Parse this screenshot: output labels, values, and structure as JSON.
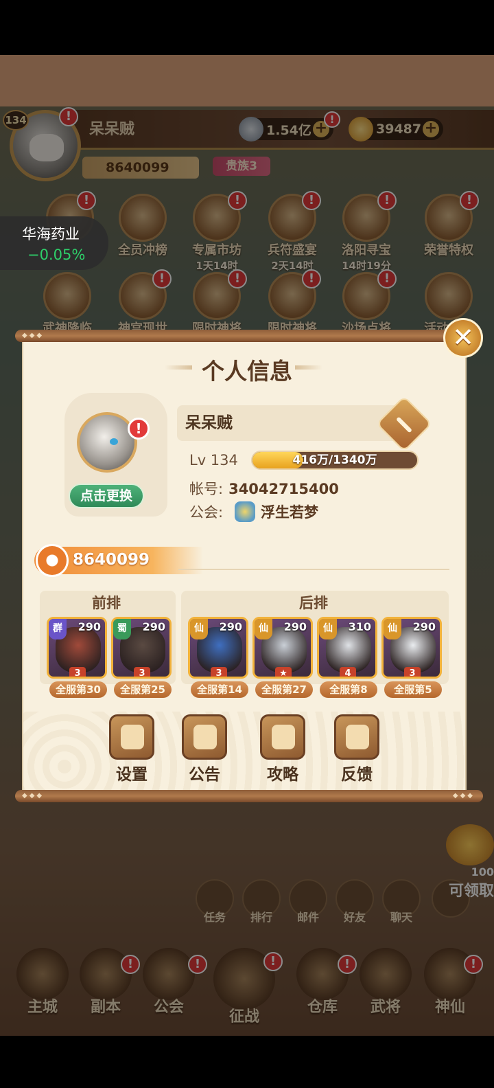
{
  "header": {
    "player_level": "134",
    "player_name": "呆呆贼",
    "silver": "1.54亿",
    "gold": "39487",
    "power": "8640099",
    "vip": "贵族3"
  },
  "events_row1": [
    {
      "label": "全员冲榜",
      "sub": ""
    },
    {
      "label": "专属市坊",
      "sub": "1天14时"
    },
    {
      "label": "兵符盛宴",
      "sub": "2天14时"
    },
    {
      "label": "洛阳寻宝",
      "sub": "14时19分"
    },
    {
      "label": "荣誉特权",
      "sub": ""
    }
  ],
  "events_row2": [
    {
      "label": "武神降临"
    },
    {
      "label": "神宫现世"
    },
    {
      "label": "限时神将"
    },
    {
      "label": "限时神将"
    },
    {
      "label": "沙场点将"
    },
    {
      "label": "活动中心"
    }
  ],
  "stock_widget": {
    "name": "华海药业",
    "change": "−0.05%"
  },
  "side_reward": {
    "count": "100",
    "label": "可领取"
  },
  "small_icons": [
    {
      "label": "任务"
    },
    {
      "label": "排行"
    },
    {
      "label": "邮件"
    },
    {
      "label": "好友"
    },
    {
      "label": "聊天"
    }
  ],
  "dock": [
    {
      "label": "主城"
    },
    {
      "label": "副本"
    },
    {
      "label": "公会"
    },
    {
      "label": "征战"
    },
    {
      "label": "仓库"
    },
    {
      "label": "武将"
    },
    {
      "label": "神仙"
    }
  ],
  "dialog": {
    "title": "个人信息",
    "change_avatar": "点击更换",
    "name": "呆呆贼",
    "level_label": "Lv 134",
    "xp_text": "416万/1340万",
    "xp_fraction": 0.31,
    "account_label": "帐号:",
    "account_value": "34042715400",
    "guild_label": "公会:",
    "guild_name": "浮生若梦",
    "power": "8640099",
    "front_label": "前排",
    "back_label": "后排",
    "heroes": [
      {
        "faction": "群",
        "faction_color": "#6a54c8",
        "level": "290",
        "stars": "3",
        "rank": "全服第30"
      },
      {
        "faction": "蜀",
        "faction_color": "#3a9a5a",
        "level": "290",
        "stars": "3",
        "rank": "全服第25"
      },
      {
        "faction": "仙",
        "faction_color": "#d9962a",
        "level": "290",
        "stars": "3",
        "rank": "全服第14"
      },
      {
        "faction": "仙",
        "faction_color": "#d9962a",
        "level": "290",
        "stars": "",
        "rank": "全服第27"
      },
      {
        "faction": "仙",
        "faction_color": "#d9962a",
        "level": "310",
        "stars": "4",
        "rank": "全服第8"
      },
      {
        "faction": "仙",
        "faction_color": "#d9962a",
        "level": "290",
        "stars": "3",
        "rank": "全服第5"
      }
    ],
    "options": [
      {
        "label": "设置"
      },
      {
        "label": "公告"
      },
      {
        "label": "攻略"
      },
      {
        "label": "反馈"
      }
    ]
  }
}
